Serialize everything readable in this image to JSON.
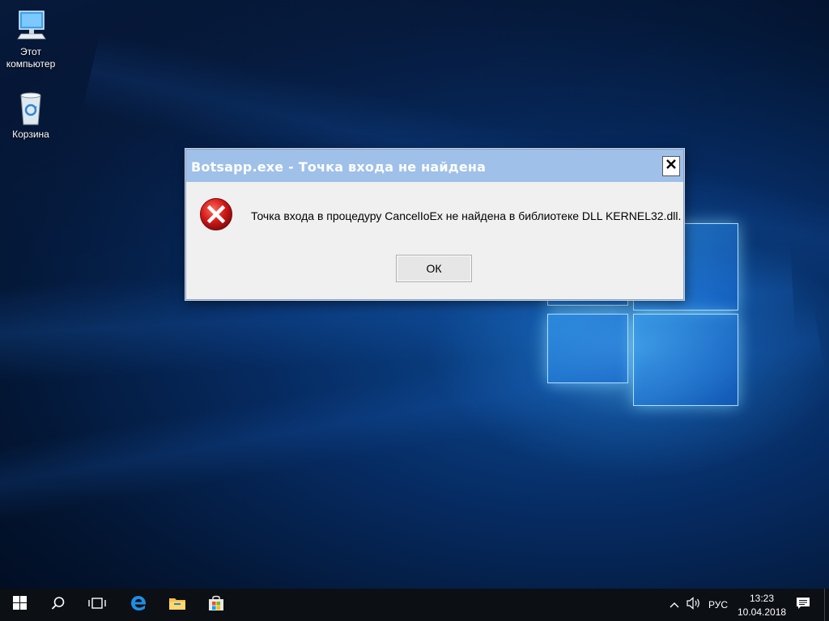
{
  "desktop": {
    "icons": [
      {
        "label_line1": "Этот",
        "label_line2": "компьютер",
        "icon": "this-pc-icon"
      },
      {
        "label": "Корзина",
        "icon": "recycle-bin-icon"
      }
    ]
  },
  "dialog": {
    "title": "Botsapp.exe - Точка входа не найдена",
    "message": "Точка входа в процедуру CancelIoEx не найдена в библиотеке DLL KERNEL32.dll.",
    "ok_label": "ОК",
    "close_symbol": "✕",
    "icon": "error-icon"
  },
  "taskbar": {
    "items": [
      "start-icon",
      "search-icon",
      "task-view-icon",
      "edge-icon",
      "file-explorer-icon",
      "store-icon"
    ],
    "tray": {
      "language": "РУС",
      "time": "13:23",
      "date": "10.04.2018"
    }
  },
  "colors": {
    "titlebar": "#9fc0e8",
    "error_red": "#d11818",
    "taskbar": "#0c0f14"
  }
}
